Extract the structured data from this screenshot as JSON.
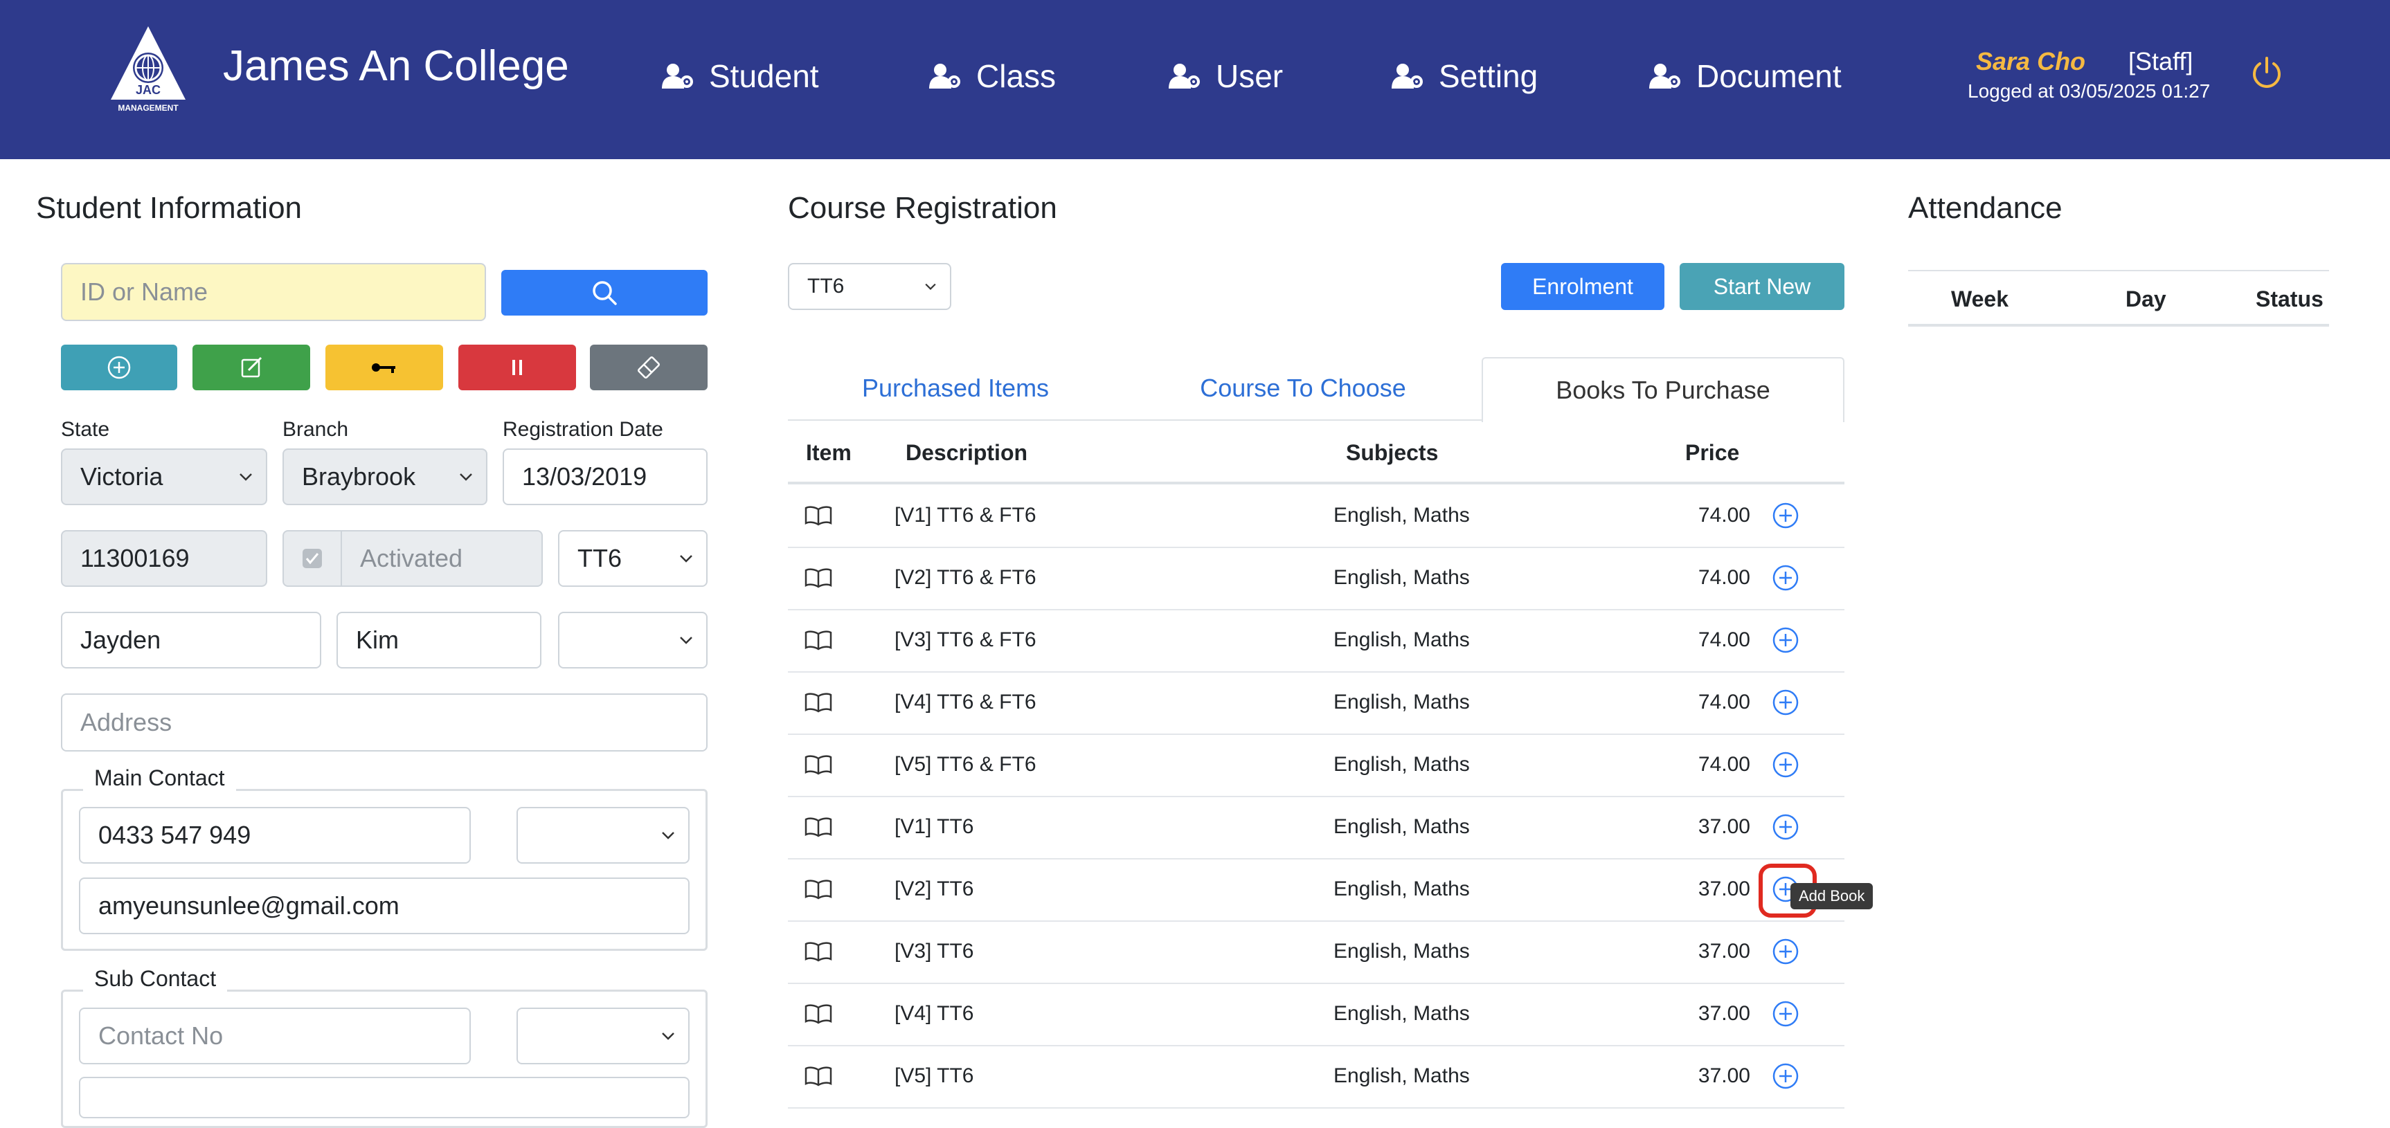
{
  "header": {
    "logo_text": "JAC",
    "logo_sub": "MANAGEMENT",
    "brand": "James An College",
    "nav": [
      {
        "label": "Student",
        "icon": "user-gear-icon"
      },
      {
        "label": "Class",
        "icon": "user-gear-icon"
      },
      {
        "label": "User",
        "icon": "user-gear-icon"
      },
      {
        "label": "Setting",
        "icon": "user-gear-icon"
      },
      {
        "label": "Document",
        "icon": "user-gear-icon"
      }
    ],
    "user_name": "Sara Cho",
    "user_role": "[Staff]",
    "login_info": "Logged at 03/05/2025 01:27"
  },
  "student": {
    "title": "Student Information",
    "search_placeholder": "ID or Name",
    "actions": [
      {
        "name": "add",
        "icon": "plus-circle-icon",
        "color": "#3fa0b5"
      },
      {
        "name": "edit",
        "icon": "edit-icon",
        "color": "#3fa14a"
      },
      {
        "name": "key",
        "icon": "key-icon",
        "color": "#f6c232"
      },
      {
        "name": "pause",
        "icon": "pause-icon",
        "color": "#d8383e"
      },
      {
        "name": "erase",
        "icon": "eraser-icon",
        "color": "#6c757d"
      }
    ],
    "state_label": "State",
    "state_value": "Victoria",
    "branch_label": "Branch",
    "branch_value": "Braybrook",
    "reg_date_label": "Registration Date",
    "reg_date_value": "13/03/2019",
    "student_id": "11300169",
    "activated_label": "Activated",
    "grade": "TT6",
    "first_name": "Jayden",
    "last_name": "Kim",
    "address_placeholder": "Address",
    "main_contact_legend": "Main Contact",
    "main_phone": "0433 547 949",
    "main_email": "amyeunsunlee@gmail.com",
    "sub_contact_legend": "Sub Contact",
    "sub_phone_placeholder": "Contact No"
  },
  "course": {
    "title": "Course Registration",
    "grade_select": "TT6",
    "enrolment_label": "Enrolment",
    "start_new_label": "Start New",
    "tabs": [
      "Purchased Items",
      "Course To Choose",
      "Books To Purchase"
    ],
    "headers": {
      "item": "Item",
      "description": "Description",
      "subjects": "Subjects",
      "price": "Price"
    },
    "rows": [
      {
        "description": "[V1] TT6 & FT6",
        "subjects": "English, Maths",
        "price": "74.00"
      },
      {
        "description": "[V2] TT6 & FT6",
        "subjects": "English, Maths",
        "price": "74.00"
      },
      {
        "description": "[V3] TT6 & FT6",
        "subjects": "English, Maths",
        "price": "74.00"
      },
      {
        "description": "[V4] TT6 & FT6",
        "subjects": "English, Maths",
        "price": "74.00"
      },
      {
        "description": "[V5] TT6 & FT6",
        "subjects": "English, Maths",
        "price": "74.00"
      },
      {
        "description": "[V1] TT6",
        "subjects": "English, Maths",
        "price": "37.00"
      },
      {
        "description": "[V2] TT6",
        "subjects": "English, Maths",
        "price": "37.00"
      },
      {
        "description": "[V3] TT6",
        "subjects": "English, Maths",
        "price": "37.00"
      },
      {
        "description": "[V4] TT6",
        "subjects": "English, Maths",
        "price": "37.00"
      },
      {
        "description": "[V5] TT6",
        "subjects": "English, Maths",
        "price": "37.00"
      }
    ],
    "tooltip": "Add Book"
  },
  "attendance": {
    "title": "Attendance",
    "headers": {
      "week": "Week",
      "day": "Day",
      "status": "Status"
    }
  },
  "colors": {
    "header_bg": "#2e3a8c",
    "primary": "#2f7cf6",
    "info": "#4aa3b5",
    "accent_name": "#f5b942"
  }
}
